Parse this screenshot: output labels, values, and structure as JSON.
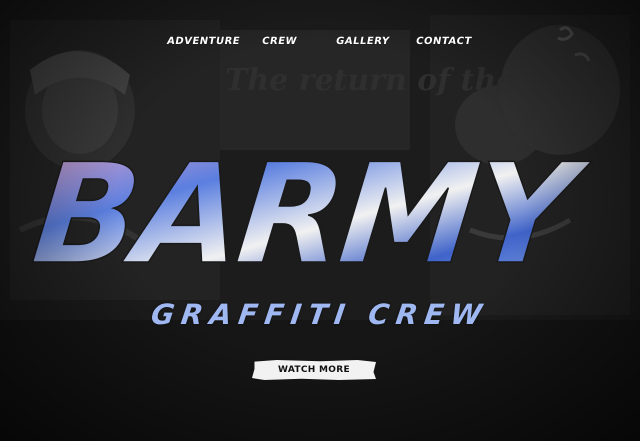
{
  "nav": {
    "items": [
      {
        "label": "ADVENTURE"
      },
      {
        "label": "CREW"
      },
      {
        "label": "GALLERY"
      },
      {
        "label": "CONTACT"
      }
    ]
  },
  "hero": {
    "brand": "BARMY",
    "subtitle": "GRAFFITI CREW",
    "cta_label": "WATCH MORE"
  },
  "background": {
    "wall_text": "The return of the"
  },
  "colors": {
    "background": "#141414",
    "subtitle": "#9fb8f2",
    "logo_blue": "#5b7fe0",
    "logo_pink": "#e8a6c8",
    "logo_white": "#f1f1f1",
    "button_bg": "#f2f2f2"
  },
  "icons": [
    "graffiti-wall-texture",
    "brush-letter-logo"
  ]
}
